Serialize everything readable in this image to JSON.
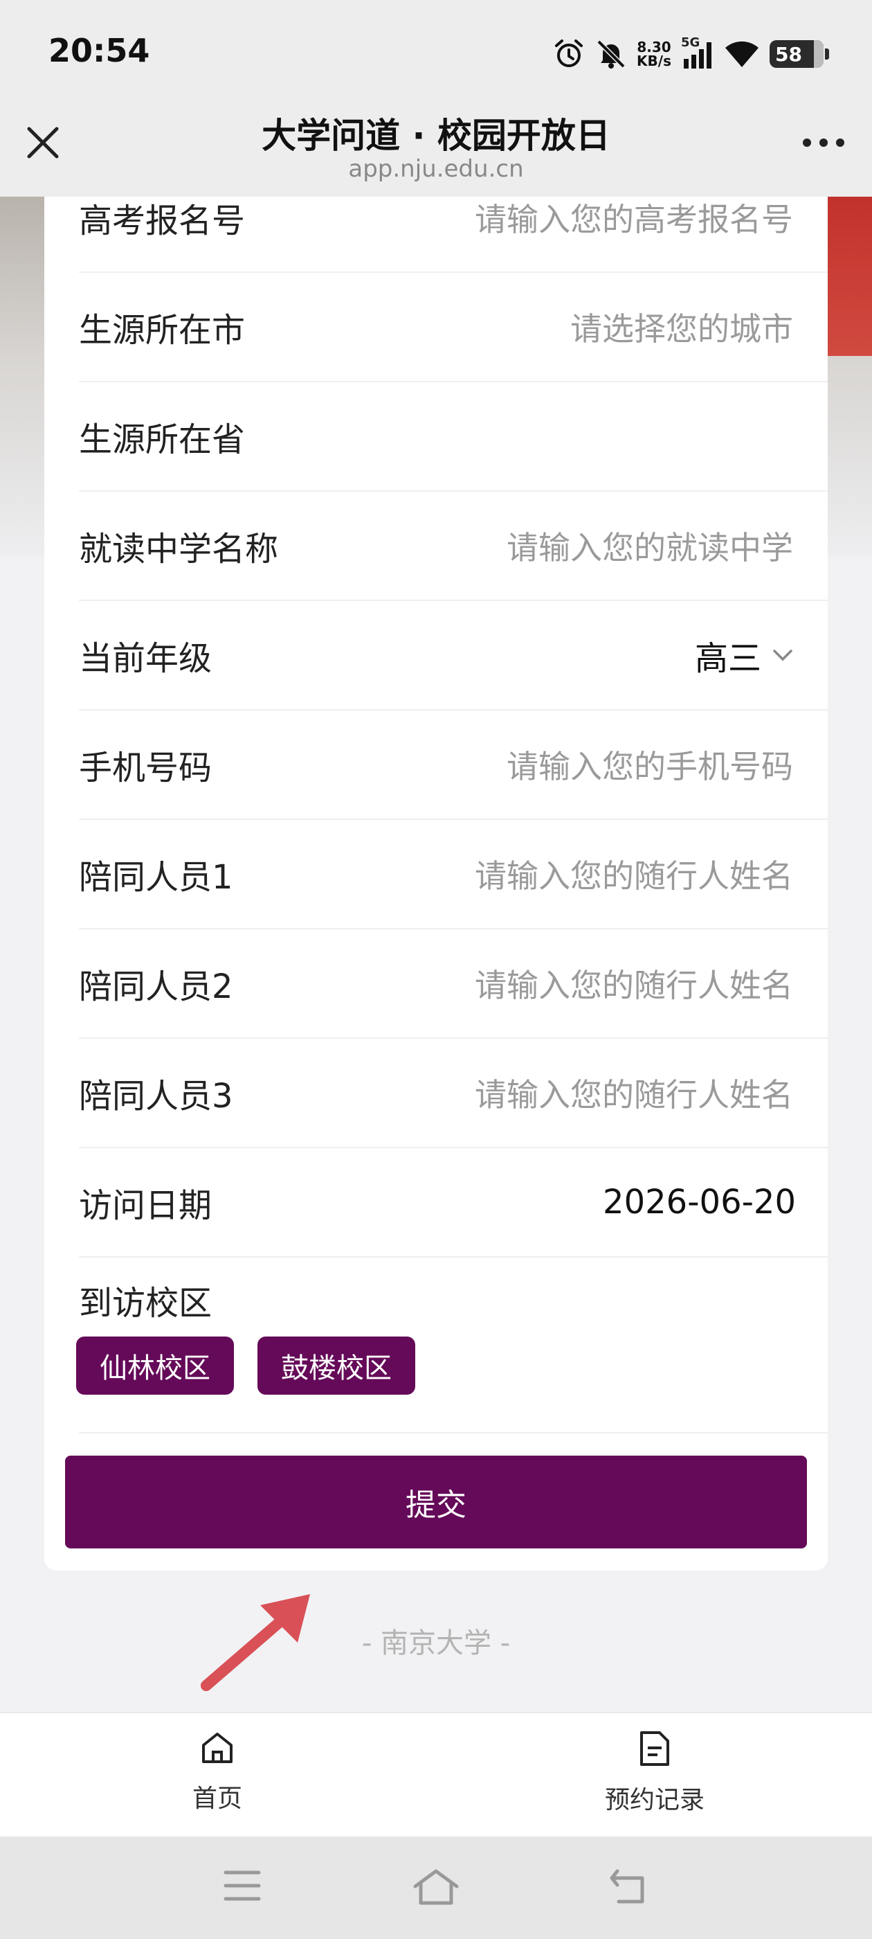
{
  "status_bar": {
    "time": "20:54",
    "net_speed_value": "8.30",
    "net_speed_unit": "KB/s",
    "network_type": "5G",
    "battery": "58",
    "icons": [
      "alarm-icon",
      "mute-bell-icon",
      "signal-icon",
      "wifi-icon",
      "battery-icon"
    ]
  },
  "title_bar": {
    "title": "大学问道 · 校园开放日",
    "url": "app.nju.edu.cn",
    "close_icon": "close-icon",
    "more_icon": "more-dots-icon"
  },
  "form": {
    "rows": [
      {
        "label": "高考报名号",
        "placeholder": "请输入您的高考报名号"
      },
      {
        "label": "生源所在市",
        "placeholder": "请选择您的城市"
      },
      {
        "label": "生源所在省",
        "placeholder": ""
      },
      {
        "label": "就读中学名称",
        "placeholder": "请输入您的就读中学"
      },
      {
        "label": "当前年级",
        "value": "高三"
      },
      {
        "label": "手机号码",
        "placeholder": "请输入您的手机号码"
      },
      {
        "label": "陪同人员1",
        "placeholder": "请输入您的随行人姓名"
      },
      {
        "label": "陪同人员2",
        "placeholder": "请输入您的随行人姓名"
      },
      {
        "label": "陪同人员3",
        "placeholder": "请输入您的随行人姓名"
      },
      {
        "label": "访问日期",
        "value": "2026-06-20"
      }
    ],
    "campus_label": "到访校区",
    "campus_options": [
      "仙林校区",
      "鼓楼校区"
    ],
    "submit_label": "提交",
    "accent_color": "#650a59"
  },
  "footer_text": "-  南京大学  -",
  "bottom_nav": {
    "items": [
      {
        "label": "首页",
        "icon": "home-icon"
      },
      {
        "label": "预约记录",
        "icon": "document-icon"
      }
    ]
  },
  "system_nav": [
    "menu-icon",
    "home-outline-icon",
    "back-icon"
  ]
}
